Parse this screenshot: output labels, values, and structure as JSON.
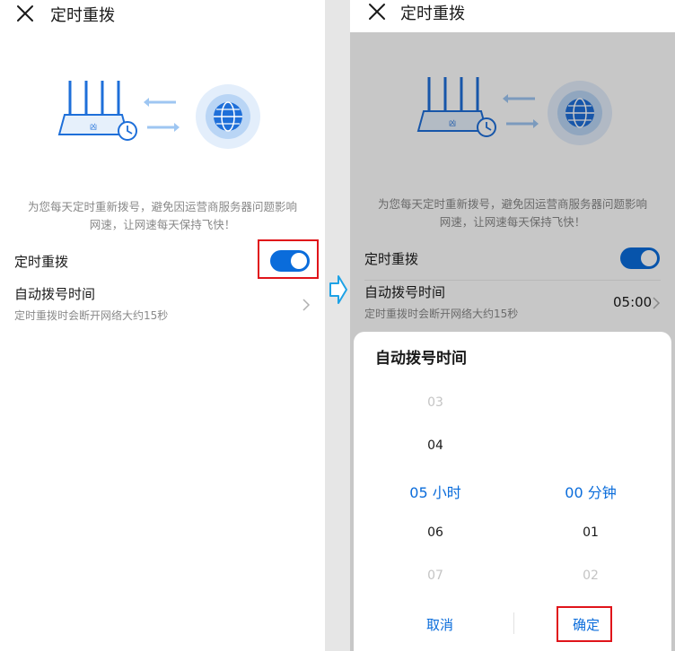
{
  "left": {
    "title": "定时重拨",
    "description_line1": "为您每天定时重新拨号，避免因运营商服务器问题影响",
    "description_line2": "网速，让网速每天保持飞快！",
    "toggle_row_label": "定时重拨",
    "toggle_on": true,
    "time_row_label": "自动拨号时间",
    "time_row_sub": "定时重拨时会断开网络大约15秒"
  },
  "right": {
    "title": "定时重拨",
    "description_line1": "为您每天定时重新拨号，避免因运营商服务器问题影响",
    "description_line2": "网速，让网速每天保持飞快！",
    "toggle_row_label": "定时重拨",
    "time_row_label": "自动拨号时间",
    "time_row_sub": "定时重拨时会断开网络大约15秒",
    "time_value": "05:00",
    "sheet": {
      "title": "自动拨号时间",
      "hours": [
        "03",
        "04",
        "05 小时",
        "06",
        "07"
      ],
      "minutes": [
        "00 分钟",
        "01",
        "02"
      ],
      "cancel_label": "取消",
      "confirm_label": "确定"
    }
  },
  "colors": {
    "accent": "#0a6cdb",
    "highlight_box": "#e0141a",
    "secondary_text": "#888888"
  },
  "icons": {
    "close": "close-icon",
    "chevron": "chevron-right-icon",
    "router": "router-icon",
    "globe": "globe-icon",
    "step_arrow": "arrow-right-icon"
  }
}
